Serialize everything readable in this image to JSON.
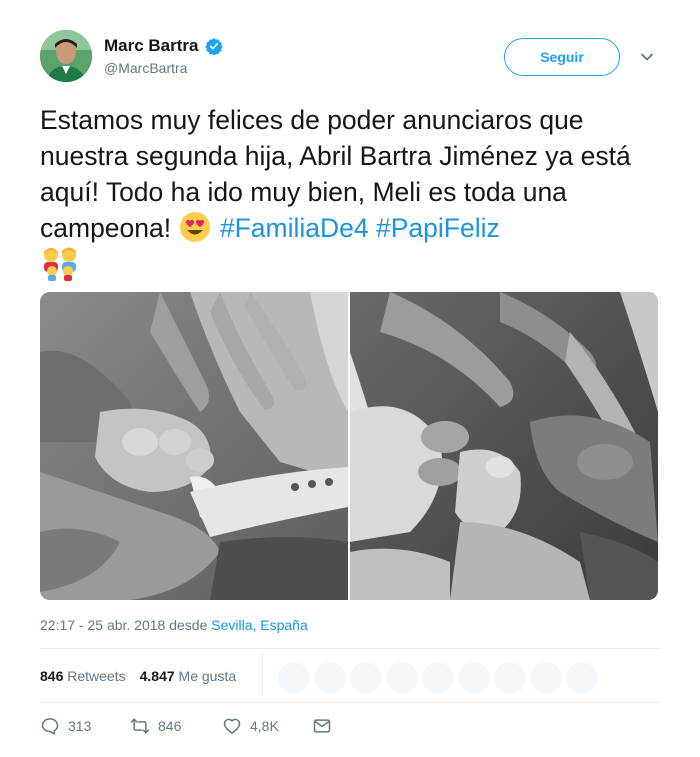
{
  "user": {
    "display_name": "Marc Bartra",
    "handle": "@MarcBartra",
    "verified": true
  },
  "follow_button": {
    "label": "Seguir"
  },
  "tweet": {
    "text_1": "Estamos muy felices de poder anunciaros que nuestra segunda hija, Abril Bartra Jiménez ya está aquí! Todo ha ido muy bien, Meli es toda una campeona! ",
    "emoji_1": "heart-eyes-emoji",
    "hashtag_1": "#FamiliaDe4",
    "hashtag_2": "#PapiFeliz",
    "emoji_2": "family-emoji"
  },
  "timestamp": {
    "time": "22:17 - 25 abr. 2018 desde ",
    "location": "Sevilla, España"
  },
  "stats": {
    "retweets_count": "846",
    "retweets_label": "Retweets",
    "likes_count": "4.847",
    "likes_label": "Me gusta"
  },
  "actions": {
    "replies": "313",
    "retweets": "846",
    "likes": "4,8K"
  },
  "colors": {
    "accent": "#1da1f2",
    "link": "#1b95e0",
    "muted": "#657786",
    "text": "#14171a"
  },
  "icons": [
    "verified-badge-icon",
    "chevron-down-icon",
    "reply-icon",
    "retweet-icon",
    "like-icon",
    "message-icon"
  ]
}
